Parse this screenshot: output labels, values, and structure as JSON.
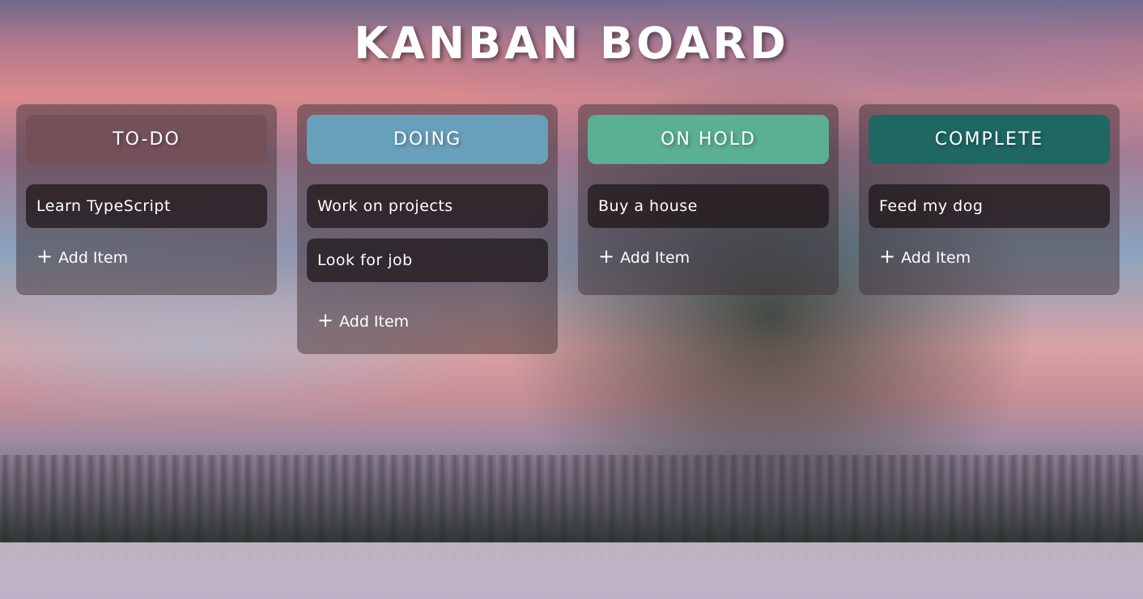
{
  "title": "KANBAN BOARD",
  "colors": {
    "todo": "#745059",
    "doing": "#68a0bc",
    "on_hold": "#5baf93",
    "complete": "#1e6762"
  },
  "columns": [
    {
      "key": "todo",
      "title": "TO-DO",
      "items": [
        "Learn TypeScript"
      ],
      "add_label": "Add Item"
    },
    {
      "key": "doing",
      "title": "DOING",
      "items": [
        "Work on projects",
        "Look for job"
      ],
      "add_label": "Add Item"
    },
    {
      "key": "on_hold",
      "title": "ON HOLD",
      "items": [
        "Buy a house"
      ],
      "add_label": "Add Item"
    },
    {
      "key": "complete",
      "title": "COMPLETE",
      "items": [
        "Feed my dog"
      ],
      "add_label": "Add Item"
    }
  ],
  "icons": {
    "add": "plus-icon"
  }
}
